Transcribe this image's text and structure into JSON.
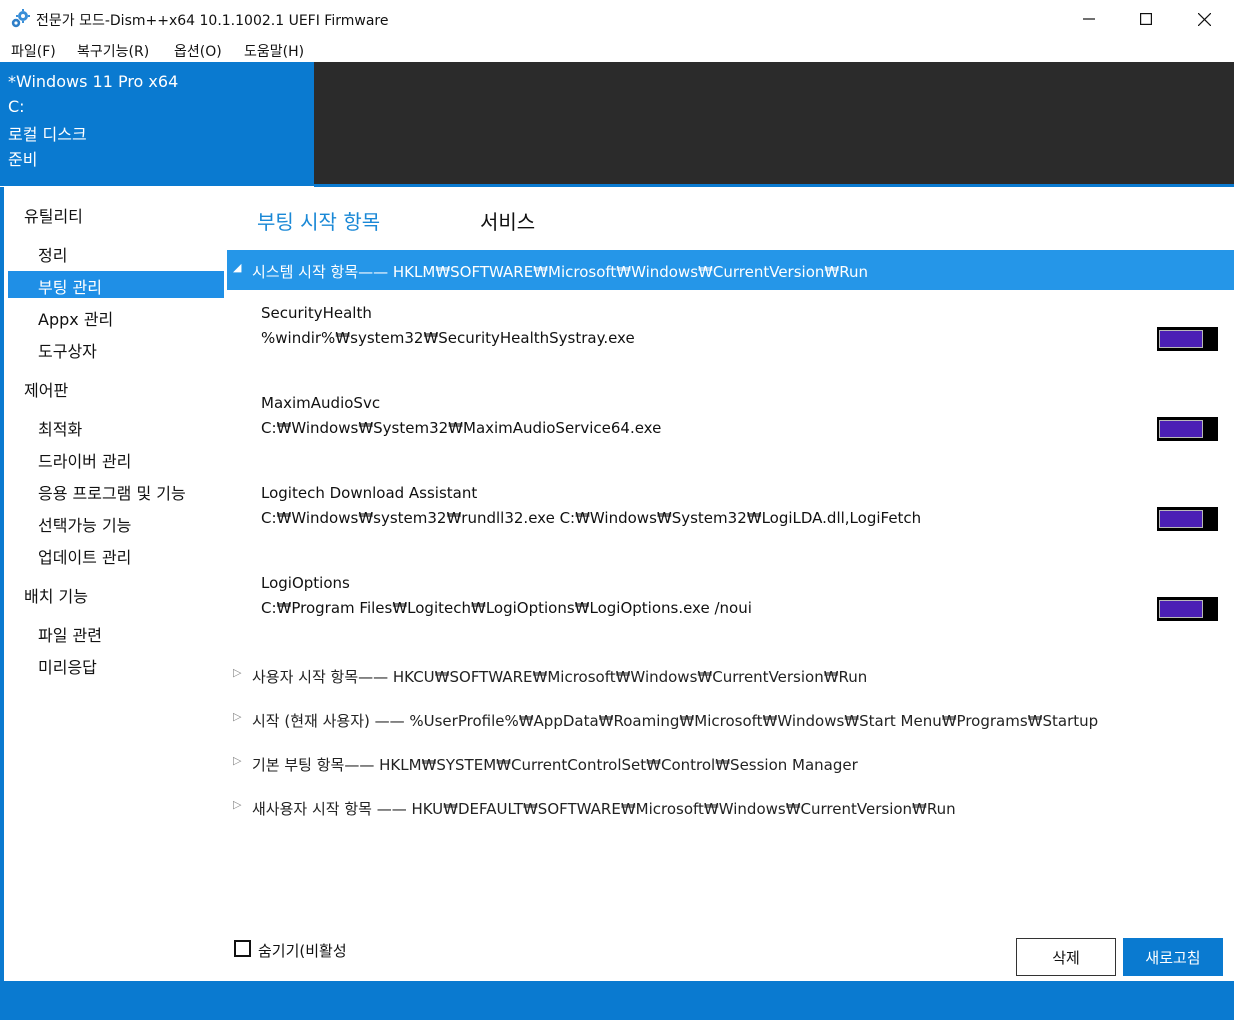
{
  "window": {
    "title": "전문가 모드-Dism++x64 10.1.1002.1 UEFI Firmware",
    "icon": "gears-icon",
    "controls": {
      "minimize_icon": "minimize-icon",
      "maximize_icon": "maximize-icon",
      "close_icon": "close-icon"
    }
  },
  "menu": {
    "items": [
      {
        "label": "파일(F)"
      },
      {
        "label": "복구기능(R)"
      },
      {
        "label": "옵션(O)"
      },
      {
        "label": "도움말(H)"
      }
    ]
  },
  "session": {
    "os": "*Windows 11 Pro x64",
    "drive": "C:",
    "disk": "로컬 디스크",
    "status": "준비"
  },
  "sidebar": {
    "groups": [
      {
        "label": "유틸리티",
        "items": [
          {
            "label": "정리"
          },
          {
            "label": "부팅 관리",
            "selected": true
          },
          {
            "label": "Appx 관리"
          },
          {
            "label": "도구상자"
          }
        ]
      },
      {
        "label": "제어판",
        "items": [
          {
            "label": "최적화"
          },
          {
            "label": "드라이버 관리"
          },
          {
            "label": "응용 프로그램 및 기능"
          },
          {
            "label": "선택가능 기능"
          },
          {
            "label": "업데이트 관리"
          }
        ]
      },
      {
        "label": "배치 기능",
        "items": [
          {
            "label": "파일 관련"
          },
          {
            "label": "미리응답"
          }
        ]
      }
    ]
  },
  "tabs": [
    {
      "label": "부팅 시작 항목",
      "active": true
    },
    {
      "label": "서비스",
      "active": false
    }
  ],
  "startup_groups": [
    {
      "label": "시스템 시작 항목—— HKLM₩SOFTWARE₩Microsoft₩Windows₩CurrentVersion₩Run",
      "expanded": true,
      "entries": [
        {
          "name": "SecurityHealth",
          "command": "%windir%₩system32₩SecurityHealthSystray.exe",
          "enabled": true
        },
        {
          "name": "MaximAudioSvc",
          "command": "C:₩Windows₩System32₩MaximAudioService64.exe",
          "enabled": true
        },
        {
          "name": "Logitech Download Assistant",
          "command": "C:₩Windows₩system32₩rundll32.exe C:₩Windows₩System32₩LogiLDA.dll,LogiFetch",
          "enabled": true
        },
        {
          "name": "LogiOptions",
          "command": "C:₩Program Files₩Logitech₩LogiOptions₩LogiOptions.exe /noui",
          "enabled": true
        }
      ]
    },
    {
      "label": "사용자 시작 항목—— HKCU₩SOFTWARE₩Microsoft₩Windows₩CurrentVersion₩Run",
      "expanded": false
    },
    {
      "label": "시작 (현재 사용자) —— %UserProfile%₩AppData₩Roaming₩Microsoft₩Windows₩Start Menu₩Programs₩Startup",
      "expanded": false
    },
    {
      "label": "기본 부팅 항목—— HKLM₩SYSTEM₩CurrentControlSet₩Control₩Session Manager",
      "expanded": false
    },
    {
      "label": "새사용자 시작 항목 —— HKU₩DEFAULT₩SOFTWARE₩Microsoft₩Windows₩CurrentVersion₩Run",
      "expanded": false
    }
  ],
  "footer": {
    "hide_disabled_label": "숨기기(비활성",
    "hide_disabled_checked": false,
    "delete_label": "삭제",
    "refresh_label": "새로고침"
  },
  "colors": {
    "accent": "#0a7ad0",
    "selection": "#1f8fe6",
    "dark_panel": "#2b2b2b",
    "toggle_on": "#4b1fb5"
  }
}
